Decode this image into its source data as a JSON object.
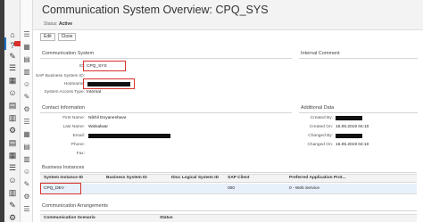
{
  "page": {
    "title": "Communication System Overview: CPQ_SYS",
    "status_label": "Status:",
    "status_value": "Active"
  },
  "toolbar": {
    "edit_label": "Edit",
    "close_label": "Close"
  },
  "communication_system": {
    "section_title": "Communication System",
    "id_label": "ID:",
    "id_value": "CPQ_SYS",
    "sap_business_system_label": "SAP Business System ID:",
    "hostname_label": "Hostname:",
    "system_access_type_label": "System Access Type:",
    "system_access_type_value": "Internal"
  },
  "internal_comment": {
    "section_title": "Internal Comment"
  },
  "contact": {
    "section_title": "Contact Information",
    "first_name_label": "First Name:",
    "first_name_value": "Nikhil Dnyaneshwar",
    "last_name_label": "Last Name:",
    "last_name_value": "Walsalwar",
    "email_label": "Email:",
    "phone_label": "Phone:",
    "fax_label": "Fax:"
  },
  "additional": {
    "section_title": "Additional Data",
    "created_by_label": "Created By:",
    "created_on_label": "Created On:",
    "created_on_value": "15.06.2019 04:10",
    "changed_by_label": "Changed By:",
    "changed_on_label": "Changed On:",
    "changed_on_value": "15.06.2019 04:10"
  },
  "business_instances": {
    "section_title": "Business Instances",
    "columns": [
      "System Instance ID",
      "Business System ID",
      "IDoc Logical System ID",
      "SAP Client",
      "Preferred Application Prot..."
    ],
    "rows": [
      [
        "CPQ_DEV",
        "",
        "",
        "000",
        "0 - Web Service"
      ]
    ]
  },
  "communication_arrangements": {
    "section_title": "Communication Arrangements",
    "columns": [
      "Communication Scenario",
      "Status"
    ]
  },
  "icons": {
    "home": "⌂",
    "help": "?",
    "tools": "✎",
    "list": "☰",
    "grid": "▦",
    "user": "☺",
    "doc": "▤",
    "chart": "▥",
    "settings": "⚙"
  }
}
